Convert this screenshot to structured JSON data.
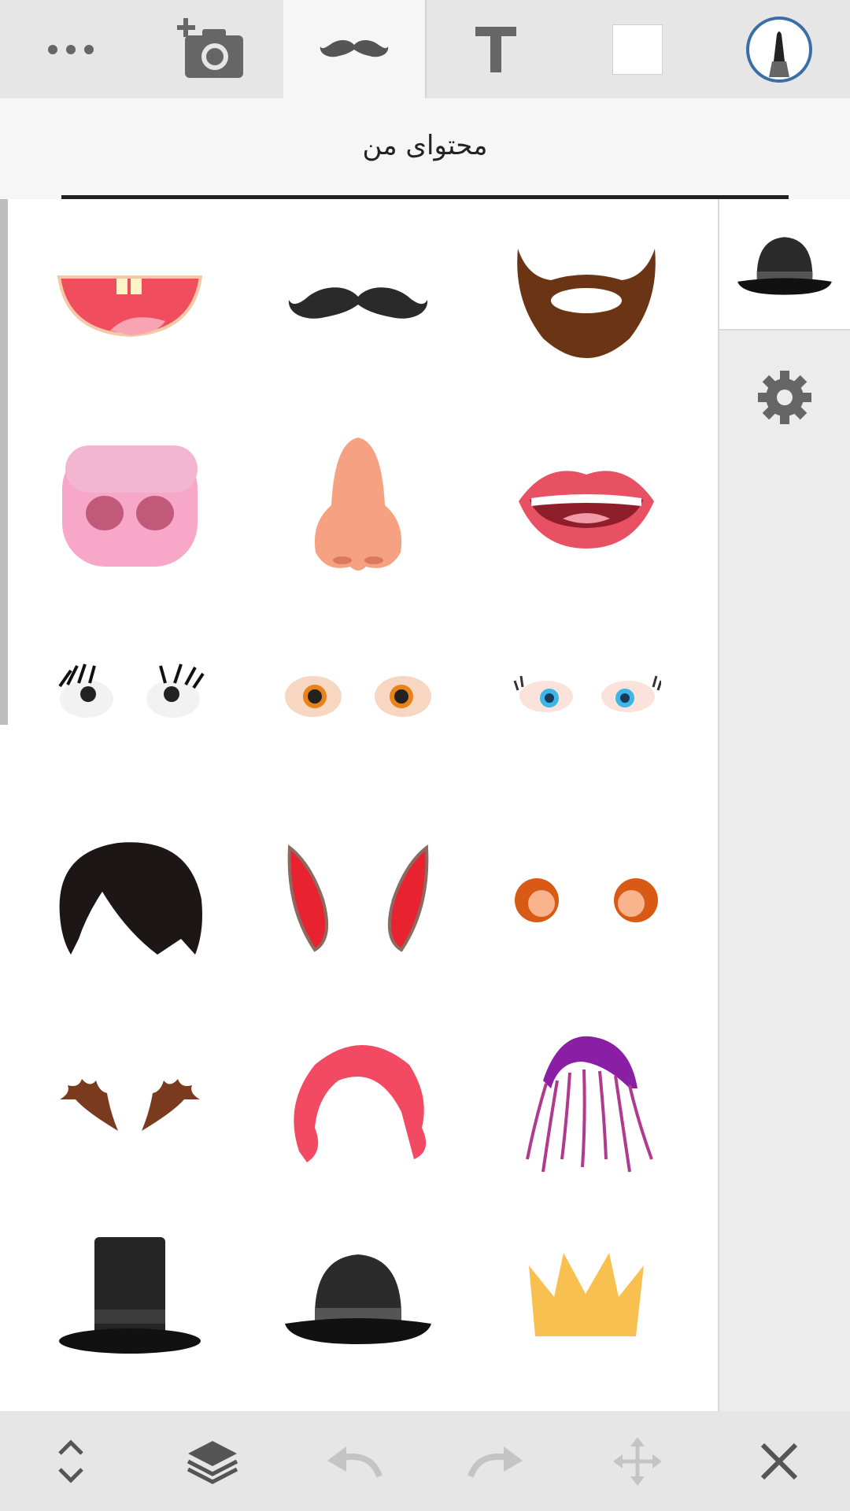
{
  "toolbar": {
    "items": [
      {
        "icon": "more-icon"
      },
      {
        "icon": "add-photo-icon"
      },
      {
        "icon": "mustache-icon",
        "active": true
      },
      {
        "icon": "text-icon",
        "label": "T"
      },
      {
        "icon": "blank-card-icon"
      },
      {
        "icon": "brush-icon"
      }
    ]
  },
  "tabs": {
    "active_label": "محتوای من"
  },
  "stickers": [
    {
      "icon": "open-mouth-teeth-icon"
    },
    {
      "icon": "mustache-sticker-icon"
    },
    {
      "icon": "beard-icon"
    },
    {
      "icon": "pig-nose-icon"
    },
    {
      "icon": "human-nose-icon"
    },
    {
      "icon": "lips-teeth-icon"
    },
    {
      "icon": "eyelash-eyes-icon"
    },
    {
      "icon": "orange-eyes-icon"
    },
    {
      "icon": "blue-eyes-icon"
    },
    {
      "icon": "black-hair-icon"
    },
    {
      "icon": "bunny-ears-icon"
    },
    {
      "icon": "round-ears-icon"
    },
    {
      "icon": "antlers-icon"
    },
    {
      "icon": "red-wig-icon"
    },
    {
      "icon": "purple-hair-icon"
    },
    {
      "icon": "top-hat-icon"
    },
    {
      "icon": "bowler-hat-icon"
    },
    {
      "icon": "crown-icon"
    }
  ],
  "rail": {
    "selected_icon": "bowler-hat-icon",
    "settings_icon": "gear-icon"
  },
  "bottombar": {
    "items": [
      {
        "icon": "expand-collapse-icon"
      },
      {
        "icon": "layers-icon"
      },
      {
        "icon": "undo-icon",
        "disabled": true
      },
      {
        "icon": "redo-icon",
        "disabled": true
      },
      {
        "icon": "move-icon",
        "disabled": true
      },
      {
        "icon": "close-icon"
      }
    ]
  },
  "colors": {
    "toolbar_bg": "#e6e6e6",
    "active_tab_bg": "#f6f6f6",
    "icon_gray": "#666666",
    "disabled_gray": "#c4c4c4",
    "brush_ring": "#3a6ea5"
  }
}
